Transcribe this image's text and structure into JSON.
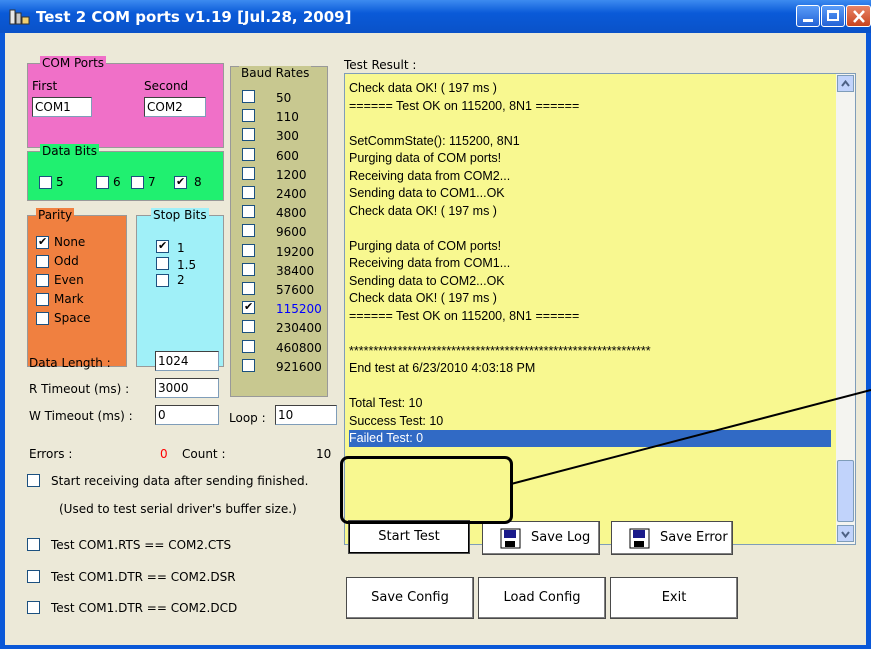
{
  "window": {
    "title": "Test 2 COM ports v1.19 [Jul.28, 2009]"
  },
  "com_ports": {
    "group_label": "COM Ports",
    "first_label": "First",
    "second_label": "Second",
    "first_value": "COM1",
    "second_value": "COM2"
  },
  "data_bits": {
    "group_label": "Data Bits",
    "options": [
      {
        "label": "5",
        "checked": false
      },
      {
        "label": "6",
        "checked": false
      },
      {
        "label": "7",
        "checked": false
      },
      {
        "label": "8",
        "checked": true
      }
    ]
  },
  "parity": {
    "group_label": "Parity",
    "options": [
      {
        "label": "None",
        "checked": true
      },
      {
        "label": "Odd",
        "checked": false
      },
      {
        "label": "Even",
        "checked": false
      },
      {
        "label": "Mark",
        "checked": false
      },
      {
        "label": "Space",
        "checked": false
      }
    ]
  },
  "stop_bits": {
    "group_label": "Stop Bits",
    "options": [
      {
        "label": "1",
        "checked": true
      },
      {
        "label": "1.5",
        "checked": false
      },
      {
        "label": "2",
        "checked": false
      }
    ]
  },
  "baud_rates": {
    "group_label": "Baud Rates",
    "options": [
      {
        "label": "50",
        "checked": false
      },
      {
        "label": "110",
        "checked": false
      },
      {
        "label": "300",
        "checked": false
      },
      {
        "label": "600",
        "checked": false
      },
      {
        "label": "1200",
        "checked": false
      },
      {
        "label": "2400",
        "checked": false
      },
      {
        "label": "4800",
        "checked": false
      },
      {
        "label": "9600",
        "checked": false
      },
      {
        "label": "19200",
        "checked": false
      },
      {
        "label": "38400",
        "checked": false
      },
      {
        "label": "57600",
        "checked": false
      },
      {
        "label": "115200",
        "checked": true
      },
      {
        "label": "230400",
        "checked": false
      },
      {
        "label": "460800",
        "checked": false
      },
      {
        "label": "921600",
        "checked": false
      }
    ]
  },
  "settings": {
    "data_length_label": "Data Length :",
    "data_length_value": "1024",
    "r_timeout_label": "R Timeout (ms) :",
    "r_timeout_value": "3000",
    "w_timeout_label": "W Timeout (ms) :",
    "w_timeout_value": "0",
    "loop_label": "Loop :",
    "loop_value": "10",
    "errors_label": "Errors :",
    "errors_value": "0",
    "count_label": "Count :",
    "count_value": "10"
  },
  "options": {
    "start_receiving": "Start receiving data after sending finished.",
    "start_receiving_note": "(Used to test serial driver's buffer size.)",
    "rts_cts": "Test COM1.RTS == COM2.CTS",
    "dtr_dsr": "Test COM1.DTR == COM2.DSR",
    "dtr_dcd": "Test COM1.DTR == COM2.DCD"
  },
  "test_result": {
    "label": "Test Result :",
    "lines": [
      "Check data OK! ( 197 ms )",
      "====== Test OK on 115200, 8N1 ======",
      "",
      "SetCommState(): 115200, 8N1",
      "Purging data of COM ports!",
      "Receiving data from COM2...",
      "Sending data to COM1...OK",
      "Check data OK! ( 197 ms )",
      "",
      "Purging data of COM ports!",
      "Receiving data from COM1...",
      "Sending data to COM2...OK",
      "Check data OK! ( 197 ms )",
      "====== Test OK on 115200, 8N1 ======",
      "",
      "**************************************************************",
      "End test at 6/23/2010 4:03:18 PM",
      "",
      "Total Test: 10",
      "Success Test: 10",
      "Failed Test: 0"
    ]
  },
  "buttons": {
    "start_test": "Start Test",
    "save_log": "Save Log",
    "save_error": "Save Error",
    "save_config": "Save Config",
    "load_config": "Load Config",
    "exit": "Exit"
  },
  "colors": {
    "com_ports": "#f070c8",
    "data_bits": "#20f070",
    "parity": "#f08040",
    "stop_bits": "#a0f0f8",
    "baud_rates": "#c8c890",
    "result_bg": "#f8f890",
    "selection": "#316ac5",
    "errors_value": "#ff0000",
    "baud_checked": "#0000ff"
  },
  "icons": [
    "app-icon",
    "minimize-icon",
    "maximize-icon",
    "close-icon",
    "floppy-icon",
    "scroll-up-icon",
    "scroll-down-icon"
  ]
}
